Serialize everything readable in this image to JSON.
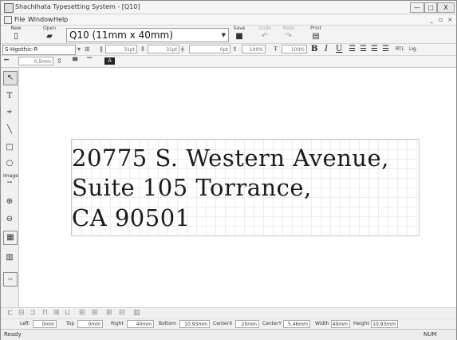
{
  "window": {
    "title": "Shachihata Typesetting System - [Q10]",
    "controls": {
      "minimize": "—",
      "maximize": "□",
      "close": "X"
    },
    "child_controls": {
      "minimize": "_",
      "restore": "▫",
      "close": "×"
    }
  },
  "menu": {
    "items": [
      "File",
      "Window",
      "Help"
    ]
  },
  "toolbar": {
    "new_label": "New",
    "open_label": "Open",
    "save_label": "Save",
    "undo_label": "Undo",
    "redo_label": "Redo",
    "print_label": "Print",
    "template_combo": "Q10 (11mm x 40mm)"
  },
  "format_bar": {
    "font": "S-Hgothic-R",
    "width_value": "31pt",
    "height_value": "31pt",
    "char_spacing_value": "0pt",
    "width_pct_value": "100%",
    "height_pct_value": "100%",
    "bold": "B",
    "italic": "I",
    "underline": "U",
    "rtl": "RTL",
    "lig": "Lig"
  },
  "line_bar": {
    "line_width": "0.5mm"
  },
  "canvas": {
    "lines": [
      "20775 S. Western Avenue,",
      "Suite 105 Torrance,",
      "CA 90501"
    ]
  },
  "position_bar": {
    "left_label": "Left",
    "left_value": "0mm",
    "top_label": "Top",
    "top_value": "0mm",
    "right_label": "Right",
    "right_value": "40mm",
    "bottom_label": "Bottom",
    "bottom_value": "10.93mm",
    "centerx_label": "CenterX",
    "centerx_value": "20mm",
    "centery_label": "CenterY",
    "centery_value": "5.46mm",
    "width_label": "Width",
    "width_value": "40mm",
    "height_label": "Height",
    "height_value": "10.93mm"
  },
  "status": {
    "left": "Ready",
    "num": "NUM"
  }
}
